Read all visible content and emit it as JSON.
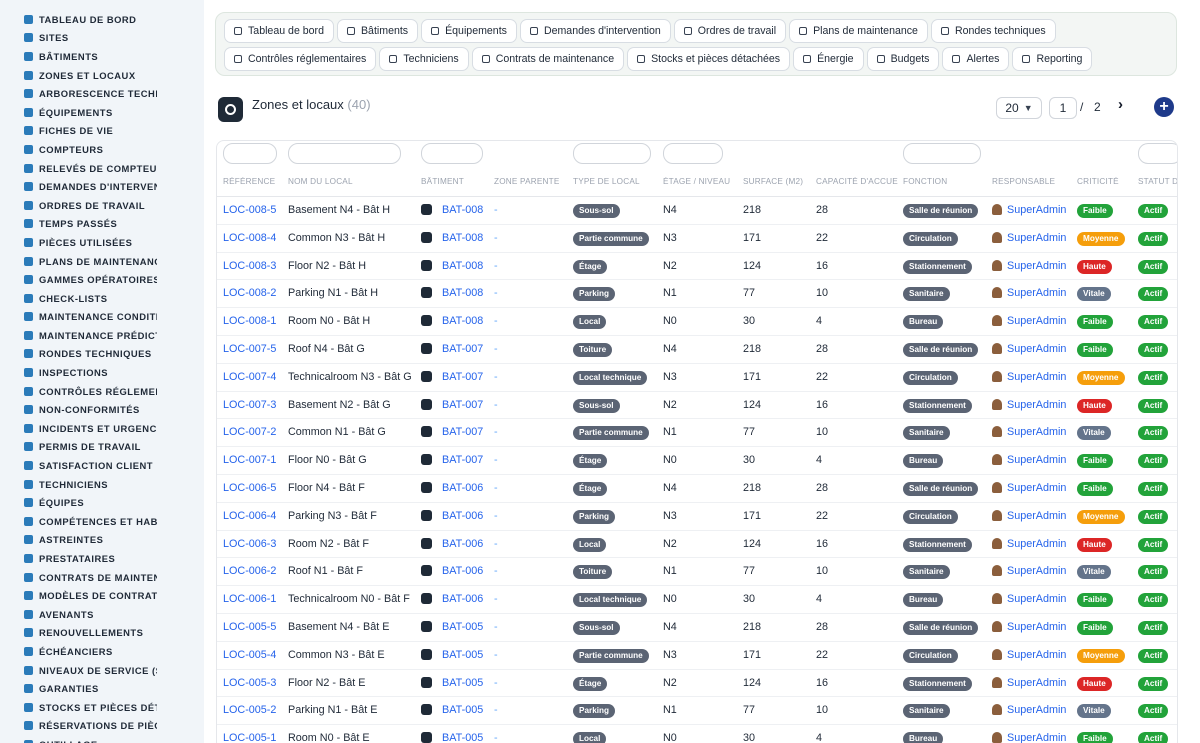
{
  "sidebar": {
    "items": [
      {
        "label": "TABLEAU DE BORD",
        "icon": "dashboard-icon"
      },
      {
        "label": "SITES",
        "icon": "location-pin-icon"
      },
      {
        "label": "BÂTIMENTS",
        "icon": "building-icon"
      },
      {
        "label": "ZONES ET LOCAUX",
        "icon": "map-icon"
      },
      {
        "label": "ARBORESCENCE TECHNIQUE",
        "icon": "tree-icon"
      },
      {
        "label": "ÉQUIPEMENTS",
        "icon": "gears-icon"
      },
      {
        "label": "FICHES DE VIE",
        "icon": "history-icon"
      },
      {
        "label": "COMPTEURS",
        "icon": "gauge-icon"
      },
      {
        "label": "RELEVÉS DE COMPTEURS",
        "icon": "list-icon"
      },
      {
        "label": "DEMANDES D'INTERVENTION",
        "icon": "question-icon"
      },
      {
        "label": "ORDRES DE TRAVAIL",
        "icon": "clipboard-icon"
      },
      {
        "label": "TEMPS PASSÉS",
        "icon": "clock-icon"
      },
      {
        "label": "PIÈCES UTILISÉES",
        "icon": "boxes-icon"
      },
      {
        "label": "PLANS DE MAINTENANCE",
        "icon": "calendar-icon"
      },
      {
        "label": "GAMMES OPÉRATOIRES",
        "icon": "tasks-icon"
      },
      {
        "label": "CHECK-LISTS",
        "icon": "checklist-icon"
      },
      {
        "label": "MAINTENANCE CONDITIONNELLE",
        "icon": "thermometer-icon"
      },
      {
        "label": "MAINTENANCE PRÉDICTIVE",
        "icon": "chart-line-icon"
      },
      {
        "label": "RONDES TECHNIQUES",
        "icon": "route-icon"
      },
      {
        "label": "INSPECTIONS",
        "icon": "search-icon"
      },
      {
        "label": "CONTRÔLES RÉGLEMENTAIRES",
        "icon": "shield-check-icon"
      },
      {
        "label": "NON-CONFORMITÉS",
        "icon": "times-circle-icon"
      },
      {
        "label": "INCIDENTS ET URGENCES",
        "icon": "warning-icon"
      },
      {
        "label": "PERMIS DE TRAVAIL",
        "icon": "document-icon"
      },
      {
        "label": "SATISFACTION CLIENT",
        "icon": "smile-icon"
      },
      {
        "label": "TECHNICIENS",
        "icon": "hard-hat-icon"
      },
      {
        "label": "ÉQUIPES",
        "icon": "users-icon"
      },
      {
        "label": "COMPÉTENCES ET HABILITATIONS",
        "icon": "certificate-icon"
      },
      {
        "label": "ASTREINTES",
        "icon": "phone-icon"
      },
      {
        "label": "PRESTATAIRES",
        "icon": "handshake-icon"
      },
      {
        "label": "CONTRATS DE MAINTENANCE",
        "icon": "file-contract-icon"
      },
      {
        "label": "MODÈLES DE CONTRATS",
        "icon": "file-icon"
      },
      {
        "label": "AVENANTS",
        "icon": "file-plus-icon"
      },
      {
        "label": "RENOUVELLEMENTS",
        "icon": "refresh-icon"
      },
      {
        "label": "ÉCHÉANCIERS",
        "icon": "calendar-check-icon"
      },
      {
        "label": "NIVEAUX DE SERVICE (SLA)",
        "icon": "target-icon"
      },
      {
        "label": "GARANTIES",
        "icon": "shield-icon"
      },
      {
        "label": "STOCKS ET PIÈCES DÉTACHÉES",
        "icon": "cubes-icon"
      },
      {
        "label": "RÉSERVATIONS DE PIÈCES",
        "icon": "bookmark-icon"
      },
      {
        "label": "OUTILLAGE",
        "icon": "wrench-icon"
      }
    ]
  },
  "nav": {
    "buttons": [
      {
        "label": "Tableau de bord",
        "icon": "dashboard-icon"
      },
      {
        "label": "Bâtiments",
        "icon": "building-icon"
      },
      {
        "label": "Équipements",
        "icon": "gears-icon"
      },
      {
        "label": "Demandes d'intervention",
        "icon": "question-icon"
      },
      {
        "label": "Ordres de travail",
        "icon": "clipboard-icon"
      },
      {
        "label": "Plans de maintenance",
        "icon": "calendar-icon"
      },
      {
        "label": "Rondes techniques",
        "icon": "route-icon"
      },
      {
        "label": "Contrôles réglementaires",
        "icon": "clipboard-check-icon"
      },
      {
        "label": "Techniciens",
        "icon": "hard-hat-icon"
      },
      {
        "label": "Contrats de maintenance",
        "icon": "file-contract-icon"
      },
      {
        "label": "Stocks et pièces détachées",
        "icon": "cubes-icon"
      },
      {
        "label": "Énergie",
        "icon": "bolt-icon"
      },
      {
        "label": "Budgets",
        "icon": "money-icon"
      },
      {
        "label": "Alertes",
        "icon": "bell-icon"
      },
      {
        "label": "Reporting",
        "icon": "pie-chart-icon"
      }
    ]
  },
  "page": {
    "title": "Zones et locaux",
    "count": "(40)",
    "per_page": "20",
    "current_page": "1",
    "page_separator": "/",
    "total_pages": "2",
    "next_symbol": "›",
    "add_symbol": "+"
  },
  "table": {
    "headers": [
      "RÉFÉRENCE",
      "NOM DU LOCAL",
      "BÂTIMENT",
      "ZONE PARENTE",
      "TYPE DE LOCAL",
      "ÉTAGE / NIVEAU",
      "SURFACE (M2)",
      "CAPACITÉ D'ACCUEIL",
      "FONCTION",
      "RESPONSABLE",
      "CRITICITÉ",
      "STATUT DU LOCAL"
    ],
    "rows": [
      {
        "ref": "LOC-008-5",
        "name": "Basement N4 - Bât H",
        "building": "BAT-008",
        "zone": "-",
        "type": "Sous-sol",
        "level": "N4",
        "surface": "218",
        "capacity": "28",
        "function": "Salle de réunion",
        "manager": "SuperAdmin",
        "criticity": "Faible",
        "status": "Actif"
      },
      {
        "ref": "LOC-008-4",
        "name": "Common N3 - Bât H",
        "building": "BAT-008",
        "zone": "-",
        "type": "Partie commune",
        "level": "N3",
        "surface": "171",
        "capacity": "22",
        "function": "Circulation",
        "manager": "SuperAdmin",
        "criticity": "Moyenne",
        "status": "Actif"
      },
      {
        "ref": "LOC-008-3",
        "name": "Floor N2 - Bât H",
        "building": "BAT-008",
        "zone": "-",
        "type": "Étage",
        "level": "N2",
        "surface": "124",
        "capacity": "16",
        "function": "Stationnement",
        "manager": "SuperAdmin",
        "criticity": "Haute",
        "status": "Actif"
      },
      {
        "ref": "LOC-008-2",
        "name": "Parking N1 - Bât H",
        "building": "BAT-008",
        "zone": "-",
        "type": "Parking",
        "level": "N1",
        "surface": "77",
        "capacity": "10",
        "function": "Sanitaire",
        "manager": "SuperAdmin",
        "criticity": "Vitale",
        "status": "Actif"
      },
      {
        "ref": "LOC-008-1",
        "name": "Room N0 - Bât H",
        "building": "BAT-008",
        "zone": "-",
        "type": "Local",
        "level": "N0",
        "surface": "30",
        "capacity": "4",
        "function": "Bureau",
        "manager": "SuperAdmin",
        "criticity": "Faible",
        "status": "Actif"
      },
      {
        "ref": "LOC-007-5",
        "name": "Roof N4 - Bât G",
        "building": "BAT-007",
        "zone": "-",
        "type": "Toiture",
        "level": "N4",
        "surface": "218",
        "capacity": "28",
        "function": "Salle de réunion",
        "manager": "SuperAdmin",
        "criticity": "Faible",
        "status": "Actif"
      },
      {
        "ref": "LOC-007-4",
        "name": "Technicalroom N3 - Bât G",
        "building": "BAT-007",
        "zone": "-",
        "type": "Local technique",
        "level": "N3",
        "surface": "171",
        "capacity": "22",
        "function": "Circulation",
        "manager": "SuperAdmin",
        "criticity": "Moyenne",
        "status": "Actif"
      },
      {
        "ref": "LOC-007-3",
        "name": "Basement N2 - Bât G",
        "building": "BAT-007",
        "zone": "-",
        "type": "Sous-sol",
        "level": "N2",
        "surface": "124",
        "capacity": "16",
        "function": "Stationnement",
        "manager": "SuperAdmin",
        "criticity": "Haute",
        "status": "Actif"
      },
      {
        "ref": "LOC-007-2",
        "name": "Common N1 - Bât G",
        "building": "BAT-007",
        "zone": "-",
        "type": "Partie commune",
        "level": "N1",
        "surface": "77",
        "capacity": "10",
        "function": "Sanitaire",
        "manager": "SuperAdmin",
        "criticity": "Vitale",
        "status": "Actif"
      },
      {
        "ref": "LOC-007-1",
        "name": "Floor N0 - Bât G",
        "building": "BAT-007",
        "zone": "-",
        "type": "Étage",
        "level": "N0",
        "surface": "30",
        "capacity": "4",
        "function": "Bureau",
        "manager": "SuperAdmin",
        "criticity": "Faible",
        "status": "Actif"
      },
      {
        "ref": "LOC-006-5",
        "name": "Floor N4 - Bât F",
        "building": "BAT-006",
        "zone": "-",
        "type": "Étage",
        "level": "N4",
        "surface": "218",
        "capacity": "28",
        "function": "Salle de réunion",
        "manager": "SuperAdmin",
        "criticity": "Faible",
        "status": "Actif"
      },
      {
        "ref": "LOC-006-4",
        "name": "Parking N3 - Bât F",
        "building": "BAT-006",
        "zone": "-",
        "type": "Parking",
        "level": "N3",
        "surface": "171",
        "capacity": "22",
        "function": "Circulation",
        "manager": "SuperAdmin",
        "criticity": "Moyenne",
        "status": "Actif"
      },
      {
        "ref": "LOC-006-3",
        "name": "Room N2 - Bât F",
        "building": "BAT-006",
        "zone": "-",
        "type": "Local",
        "level": "N2",
        "surface": "124",
        "capacity": "16",
        "function": "Stationnement",
        "manager": "SuperAdmin",
        "criticity": "Haute",
        "status": "Actif"
      },
      {
        "ref": "LOC-006-2",
        "name": "Roof N1 - Bât F",
        "building": "BAT-006",
        "zone": "-",
        "type": "Toiture",
        "level": "N1",
        "surface": "77",
        "capacity": "10",
        "function": "Sanitaire",
        "manager": "SuperAdmin",
        "criticity": "Vitale",
        "status": "Actif"
      },
      {
        "ref": "LOC-006-1",
        "name": "Technicalroom N0 - Bât F",
        "building": "BAT-006",
        "zone": "-",
        "type": "Local technique",
        "level": "N0",
        "surface": "30",
        "capacity": "4",
        "function": "Bureau",
        "manager": "SuperAdmin",
        "criticity": "Faible",
        "status": "Actif"
      },
      {
        "ref": "LOC-005-5",
        "name": "Basement N4 - Bât E",
        "building": "BAT-005",
        "zone": "-",
        "type": "Sous-sol",
        "level": "N4",
        "surface": "218",
        "capacity": "28",
        "function": "Salle de réunion",
        "manager": "SuperAdmin",
        "criticity": "Faible",
        "status": "Actif"
      },
      {
        "ref": "LOC-005-4",
        "name": "Common N3 - Bât E",
        "building": "BAT-005",
        "zone": "-",
        "type": "Partie commune",
        "level": "N3",
        "surface": "171",
        "capacity": "22",
        "function": "Circulation",
        "manager": "SuperAdmin",
        "criticity": "Moyenne",
        "status": "Actif"
      },
      {
        "ref": "LOC-005-3",
        "name": "Floor N2 - Bât E",
        "building": "BAT-005",
        "zone": "-",
        "type": "Étage",
        "level": "N2",
        "surface": "124",
        "capacity": "16",
        "function": "Stationnement",
        "manager": "SuperAdmin",
        "criticity": "Haute",
        "status": "Actif"
      },
      {
        "ref": "LOC-005-2",
        "name": "Parking N1 - Bât E",
        "building": "BAT-005",
        "zone": "-",
        "type": "Parking",
        "level": "N1",
        "surface": "77",
        "capacity": "10",
        "function": "Sanitaire",
        "manager": "SuperAdmin",
        "criticity": "Vitale",
        "status": "Actif"
      },
      {
        "ref": "LOC-005-1",
        "name": "Room N0 - Bât E",
        "building": "BAT-005",
        "zone": "-",
        "type": "Local",
        "level": "N0",
        "surface": "30",
        "capacity": "4",
        "function": "Bureau",
        "manager": "SuperAdmin",
        "criticity": "Faible",
        "status": "Actif"
      }
    ]
  },
  "colors": {
    "accent": "#2563eb",
    "sidebar_icon": "#2b7bb9",
    "badge_neutral": "#5b6474",
    "criticity": {
      "Faible": "#22a33a",
      "Moyenne": "#f59e0b",
      "Haute": "#dc2626",
      "Vitale": "#64748b"
    },
    "status": {
      "Actif": "#22a33a"
    }
  }
}
